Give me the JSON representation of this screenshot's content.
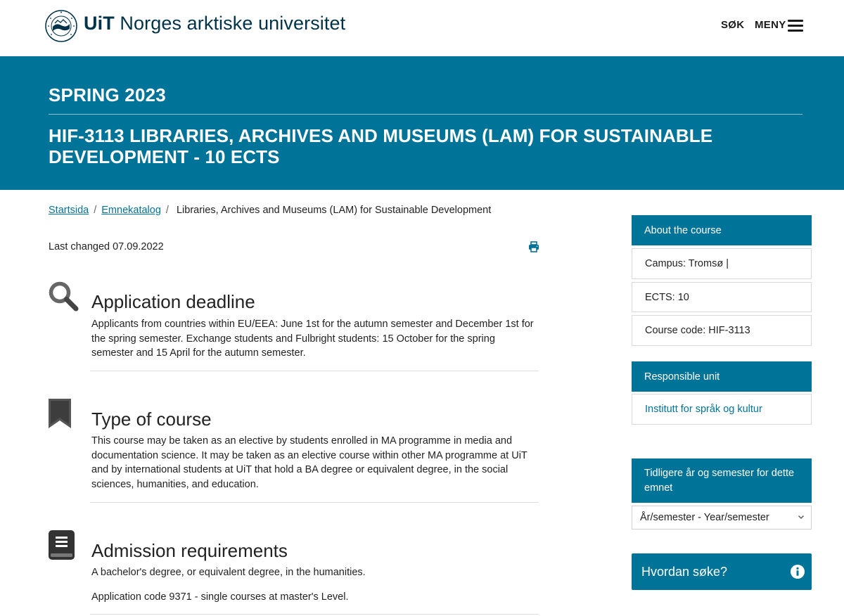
{
  "header": {
    "logo_uit": "UiT",
    "logo_name": "Norges arktiske universitet",
    "search_label": "SØK",
    "menu_label": "MENY"
  },
  "banner": {
    "semester": "SPRING 2023",
    "course_title": "HIF-3113 LIBRARIES, ARCHIVES AND MUSEUMS (LAM) FOR SUSTAINABLE DEVELOPMENT - 10 ECTS"
  },
  "breadcrumb": {
    "items": [
      "Startsida",
      "Emnekatalog",
      "Libraries, Archives and Museums (LAM) for Sustainable Development"
    ],
    "separator": "/"
  },
  "meta": {
    "last_changed": "Last changed 07.09.2022"
  },
  "sections": [
    {
      "heading": "Application deadline",
      "icon": "magnifier-icon",
      "text": "Applicants from countries within EU/EEA: June 1st for the autumn semester and December 1st for the spring semester. Exchange students and Fulbright students: 15 October for the spring semester and 15 April for the autumn semester."
    },
    {
      "heading": "Type of course",
      "icon": "bookmark-icon",
      "text": "This course may be taken as an elective by students enrolled in MA programme in media and documentation science. It may be taken as an elective course within other MA programme at UiT and by international students at UiT that hold a BA degree or equivalent degree, in the social sciences, humanities, and education."
    },
    {
      "heading": "Admission requirements",
      "icon": "book-icon",
      "text": "A bachelor's degree, or equivalent degree, in the humanities.",
      "text2": "Application code 9371 - single courses at master's Level."
    }
  ],
  "sidebar": {
    "about_heading": "About the course",
    "campus": "Campus: Tromsø |",
    "ects": "ECTS: 10",
    "course_code": "Course code: HIF-3113",
    "responsible_heading": "Responsible unit",
    "responsible_link": "Institutt for språk og kultur",
    "previous_heading": "Tidligere år og semester for dette emnet",
    "select_value": "År/semester - Year/semester",
    "how_to_apply": "Hvordan søke?"
  },
  "colors": {
    "brand": "#007398",
    "logo_text": "#003349"
  }
}
